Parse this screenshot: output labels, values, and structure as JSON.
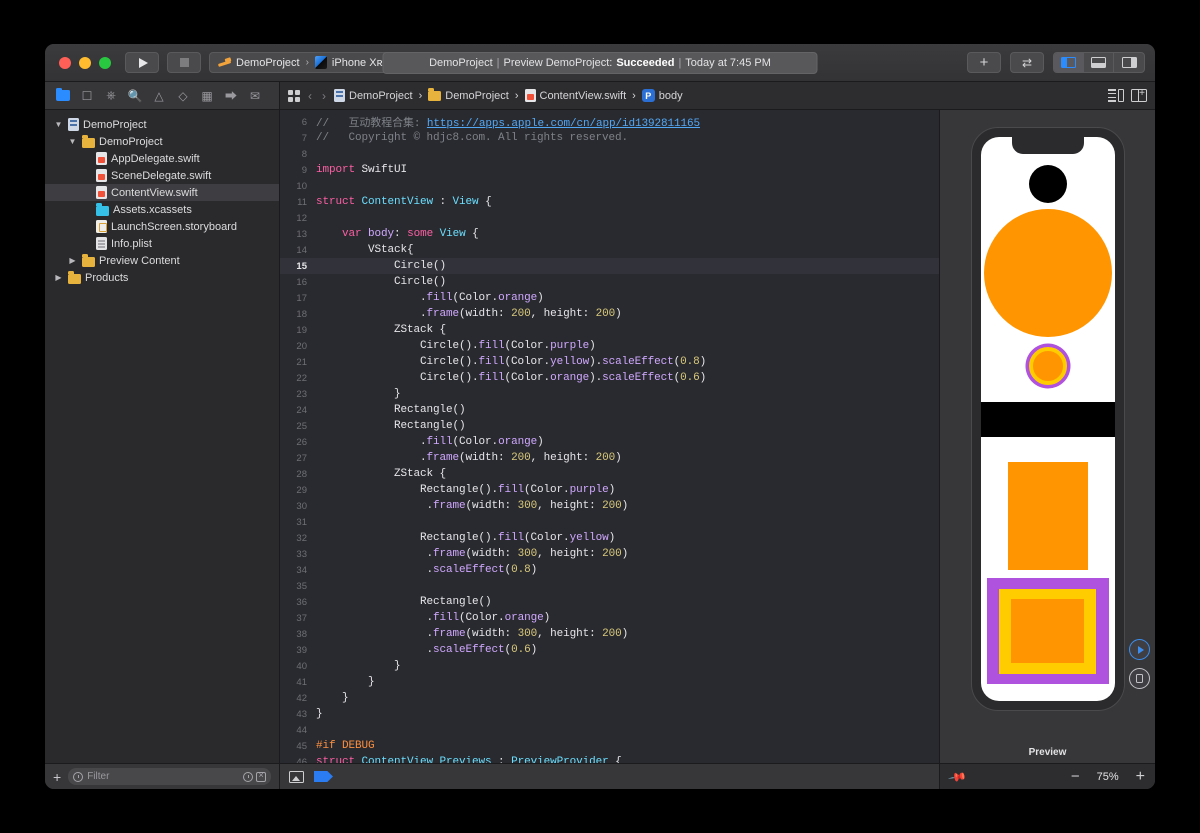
{
  "window": {
    "traffic_lights": [
      "close",
      "minimize",
      "zoom"
    ],
    "run_button": "run",
    "stop_button": "stop",
    "scheme": {
      "project": "DemoProject",
      "chevron": "›",
      "device": "iPhone Xʀ"
    },
    "status": {
      "project": "DemoProject",
      "sep": "|",
      "activity": "Preview DemoProject:",
      "result": "Succeeded",
      "time": "Today at 7:45 PM"
    },
    "right_buttons": {
      "add": "+",
      "swap": "⇄"
    },
    "pane_toggles": [
      "navigator-pane",
      "debug-pane",
      "inspector-pane"
    ]
  },
  "navigator_toolbar": {
    "icons": [
      "project-navigator-icon",
      "source-control-navigator-icon",
      "symbol-navigator-icon",
      "find-navigator-icon",
      "issue-navigator-icon",
      "test-navigator-icon",
      "debug-navigator-icon",
      "breakpoint-navigator-icon",
      "report-navigator-icon"
    ]
  },
  "jumpbar": {
    "back": "‹",
    "forward": "›",
    "separator": "›",
    "crumbs": [
      {
        "label": "DemoProject",
        "icon": "project-icon"
      },
      {
        "label": "DemoProject",
        "icon": "folder-icon"
      },
      {
        "label": "ContentView.swift",
        "icon": "swift-file-icon"
      },
      {
        "label": "body",
        "icon": "property-badge"
      }
    ],
    "badge_letter": "P"
  },
  "navigator": {
    "tree": [
      {
        "label": "DemoProject",
        "depth": 0,
        "twisty": "▼",
        "icon": "proj",
        "selected": false
      },
      {
        "label": "DemoProject",
        "depth": 1,
        "twisty": "▼",
        "icon": "folder",
        "selected": false
      },
      {
        "label": "AppDelegate.swift",
        "depth": 2,
        "twisty": "",
        "icon": "swift",
        "selected": false
      },
      {
        "label": "SceneDelegate.swift",
        "depth": 2,
        "twisty": "",
        "icon": "swift",
        "selected": false
      },
      {
        "label": "ContentView.swift",
        "depth": 2,
        "twisty": "",
        "icon": "swift",
        "selected": true
      },
      {
        "label": "Assets.xcassets",
        "depth": 2,
        "twisty": "",
        "icon": "assets",
        "selected": false
      },
      {
        "label": "LaunchScreen.storyboard",
        "depth": 2,
        "twisty": "",
        "icon": "story",
        "selected": false
      },
      {
        "label": "Info.plist",
        "depth": 2,
        "twisty": "",
        "icon": "plist",
        "selected": false
      },
      {
        "label": "Preview Content",
        "depth": 1,
        "twisty": "▶",
        "icon": "folder",
        "selected": false
      },
      {
        "label": "Products",
        "depth": 0,
        "twisty": "▶",
        "icon": "folder",
        "selected": false
      }
    ],
    "filter": {
      "add_label": "+",
      "placeholder": "Filter",
      "recent_icon": "clock-icon",
      "clear_icon": "clear-icon"
    }
  },
  "editor": {
    "current_line": 15,
    "lines": [
      {
        "n": 6,
        "tokens": [
          {
            "t": "//   互动教程合集: ",
            "c": "cmt"
          },
          {
            "t": "https://apps.apple.com/cn/app/id1392811165",
            "c": "lnk"
          }
        ]
      },
      {
        "n": 7,
        "tokens": [
          {
            "t": "//   Copyright © hdjc8.com. All rights reserved.",
            "c": "cmt"
          }
        ]
      },
      {
        "n": 8,
        "tokens": []
      },
      {
        "n": 9,
        "tokens": [
          {
            "t": "import ",
            "c": "kw"
          },
          {
            "t": "SwiftUI",
            "c": "pln"
          }
        ]
      },
      {
        "n": 10,
        "tokens": []
      },
      {
        "n": 11,
        "tokens": [
          {
            "t": "struct ",
            "c": "kw"
          },
          {
            "t": "ContentView",
            "c": "typ"
          },
          {
            "t": " : ",
            "c": "pln"
          },
          {
            "t": "View",
            "c": "typ"
          },
          {
            "t": " {",
            "c": "pln"
          }
        ]
      },
      {
        "n": 12,
        "tokens": []
      },
      {
        "n": 13,
        "tokens": [
          {
            "t": "    ",
            "c": "pln"
          },
          {
            "t": "var ",
            "c": "kw"
          },
          {
            "t": "body",
            "c": "idn"
          },
          {
            "t": ": ",
            "c": "pln"
          },
          {
            "t": "some ",
            "c": "kw"
          },
          {
            "t": "View",
            "c": "typ"
          },
          {
            "t": " {",
            "c": "pln"
          }
        ]
      },
      {
        "n": 14,
        "tokens": [
          {
            "t": "        VStack{",
            "c": "pln"
          }
        ]
      },
      {
        "n": 15,
        "tokens": [
          {
            "t": "            Circle()",
            "c": "pln"
          }
        ]
      },
      {
        "n": 16,
        "tokens": [
          {
            "t": "            Circle()",
            "c": "pln"
          }
        ]
      },
      {
        "n": 17,
        "tokens": [
          {
            "t": "                .",
            "c": "pln"
          },
          {
            "t": "fill",
            "c": "mem"
          },
          {
            "t": "(Color.",
            "c": "pln"
          },
          {
            "t": "orange",
            "c": "mem"
          },
          {
            "t": ")",
            "c": "pln"
          }
        ]
      },
      {
        "n": 18,
        "tokens": [
          {
            "t": "                .",
            "c": "pln"
          },
          {
            "t": "frame",
            "c": "mem"
          },
          {
            "t": "(width: ",
            "c": "pln"
          },
          {
            "t": "200",
            "c": "num"
          },
          {
            "t": ", height: ",
            "c": "pln"
          },
          {
            "t": "200",
            "c": "num"
          },
          {
            "t": ")",
            "c": "pln"
          }
        ]
      },
      {
        "n": 19,
        "tokens": [
          {
            "t": "            ZStack {",
            "c": "pln"
          }
        ]
      },
      {
        "n": 20,
        "tokens": [
          {
            "t": "                Circle().",
            "c": "pln"
          },
          {
            "t": "fill",
            "c": "mem"
          },
          {
            "t": "(Color.",
            "c": "pln"
          },
          {
            "t": "purple",
            "c": "mem"
          },
          {
            "t": ")",
            "c": "pln"
          }
        ]
      },
      {
        "n": 21,
        "tokens": [
          {
            "t": "                Circle().",
            "c": "pln"
          },
          {
            "t": "fill",
            "c": "mem"
          },
          {
            "t": "(Color.",
            "c": "pln"
          },
          {
            "t": "yellow",
            "c": "mem"
          },
          {
            "t": ").",
            "c": "pln"
          },
          {
            "t": "scaleEffect",
            "c": "mem"
          },
          {
            "t": "(",
            "c": "pln"
          },
          {
            "t": "0.8",
            "c": "num"
          },
          {
            "t": ")",
            "c": "pln"
          }
        ]
      },
      {
        "n": 22,
        "tokens": [
          {
            "t": "                Circle().",
            "c": "pln"
          },
          {
            "t": "fill",
            "c": "mem"
          },
          {
            "t": "(Color.",
            "c": "pln"
          },
          {
            "t": "orange",
            "c": "mem"
          },
          {
            "t": ").",
            "c": "pln"
          },
          {
            "t": "scaleEffect",
            "c": "mem"
          },
          {
            "t": "(",
            "c": "pln"
          },
          {
            "t": "0.6",
            "c": "num"
          },
          {
            "t": ")",
            "c": "pln"
          }
        ]
      },
      {
        "n": 23,
        "tokens": [
          {
            "t": "            }",
            "c": "pln"
          }
        ]
      },
      {
        "n": 24,
        "tokens": [
          {
            "t": "            Rectangle()",
            "c": "pln"
          }
        ]
      },
      {
        "n": 25,
        "tokens": [
          {
            "t": "            Rectangle()",
            "c": "pln"
          }
        ]
      },
      {
        "n": 26,
        "tokens": [
          {
            "t": "                .",
            "c": "pln"
          },
          {
            "t": "fill",
            "c": "mem"
          },
          {
            "t": "(Color.",
            "c": "pln"
          },
          {
            "t": "orange",
            "c": "mem"
          },
          {
            "t": ")",
            "c": "pln"
          }
        ]
      },
      {
        "n": 27,
        "tokens": [
          {
            "t": "                .",
            "c": "pln"
          },
          {
            "t": "frame",
            "c": "mem"
          },
          {
            "t": "(width: ",
            "c": "pln"
          },
          {
            "t": "200",
            "c": "num"
          },
          {
            "t": ", height: ",
            "c": "pln"
          },
          {
            "t": "200",
            "c": "num"
          },
          {
            "t": ")",
            "c": "pln"
          }
        ]
      },
      {
        "n": 28,
        "tokens": [
          {
            "t": "            ZStack {",
            "c": "pln"
          }
        ]
      },
      {
        "n": 29,
        "tokens": [
          {
            "t": "                Rectangle().",
            "c": "pln"
          },
          {
            "t": "fill",
            "c": "mem"
          },
          {
            "t": "(Color.",
            "c": "pln"
          },
          {
            "t": "purple",
            "c": "mem"
          },
          {
            "t": ")",
            "c": "pln"
          }
        ]
      },
      {
        "n": 30,
        "tokens": [
          {
            "t": "                 .",
            "c": "pln"
          },
          {
            "t": "frame",
            "c": "mem"
          },
          {
            "t": "(width: ",
            "c": "pln"
          },
          {
            "t": "300",
            "c": "num"
          },
          {
            "t": ", height: ",
            "c": "pln"
          },
          {
            "t": "200",
            "c": "num"
          },
          {
            "t": ")",
            "c": "pln"
          }
        ]
      },
      {
        "n": 31,
        "tokens": []
      },
      {
        "n": 32,
        "tokens": [
          {
            "t": "                Rectangle().",
            "c": "pln"
          },
          {
            "t": "fill",
            "c": "mem"
          },
          {
            "t": "(Color.",
            "c": "pln"
          },
          {
            "t": "yellow",
            "c": "mem"
          },
          {
            "t": ")",
            "c": "pln"
          }
        ]
      },
      {
        "n": 33,
        "tokens": [
          {
            "t": "                 .",
            "c": "pln"
          },
          {
            "t": "frame",
            "c": "mem"
          },
          {
            "t": "(width: ",
            "c": "pln"
          },
          {
            "t": "300",
            "c": "num"
          },
          {
            "t": ", height: ",
            "c": "pln"
          },
          {
            "t": "200",
            "c": "num"
          },
          {
            "t": ")",
            "c": "pln"
          }
        ]
      },
      {
        "n": 34,
        "tokens": [
          {
            "t": "                 .",
            "c": "pln"
          },
          {
            "t": "scaleEffect",
            "c": "mem"
          },
          {
            "t": "(",
            "c": "pln"
          },
          {
            "t": "0.8",
            "c": "num"
          },
          {
            "t": ")",
            "c": "pln"
          }
        ]
      },
      {
        "n": 35,
        "tokens": []
      },
      {
        "n": 36,
        "tokens": [
          {
            "t": "                Rectangle()",
            "c": "pln"
          }
        ]
      },
      {
        "n": 37,
        "tokens": [
          {
            "t": "                 .",
            "c": "pln"
          },
          {
            "t": "fill",
            "c": "mem"
          },
          {
            "t": "(Color.",
            "c": "pln"
          },
          {
            "t": "orange",
            "c": "mem"
          },
          {
            "t": ")",
            "c": "pln"
          }
        ]
      },
      {
        "n": 38,
        "tokens": [
          {
            "t": "                 .",
            "c": "pln"
          },
          {
            "t": "frame",
            "c": "mem"
          },
          {
            "t": "(width: ",
            "c": "pln"
          },
          {
            "t": "300",
            "c": "num"
          },
          {
            "t": ", height: ",
            "c": "pln"
          },
          {
            "t": "200",
            "c": "num"
          },
          {
            "t": ")",
            "c": "pln"
          }
        ]
      },
      {
        "n": 39,
        "tokens": [
          {
            "t": "                 .",
            "c": "pln"
          },
          {
            "t": "scaleEffect",
            "c": "mem"
          },
          {
            "t": "(",
            "c": "pln"
          },
          {
            "t": "0.6",
            "c": "num"
          },
          {
            "t": ")",
            "c": "pln"
          }
        ]
      },
      {
        "n": 40,
        "tokens": [
          {
            "t": "            }",
            "c": "pln"
          }
        ]
      },
      {
        "n": 41,
        "tokens": [
          {
            "t": "        }",
            "c": "pln"
          }
        ]
      },
      {
        "n": 42,
        "tokens": [
          {
            "t": "    }",
            "c": "pln"
          }
        ]
      },
      {
        "n": 43,
        "tokens": [
          {
            "t": "}",
            "c": "pln"
          }
        ]
      },
      {
        "n": 44,
        "tokens": []
      },
      {
        "n": 45,
        "tokens": [
          {
            "t": "#if DEBUG",
            "c": "pre"
          }
        ]
      },
      {
        "n": 46,
        "tokens": [
          {
            "t": "struct ",
            "c": "kw"
          },
          {
            "t": "ContentView_Previews",
            "c": "typ"
          },
          {
            "t": " : ",
            "c": "pln"
          },
          {
            "t": "PreviewProvider",
            "c": "typ"
          },
          {
            "t": " {",
            "c": "pln"
          }
        ]
      }
    ],
    "bottom_icons": [
      "assistant-editor-icon",
      "issue-tag-icon"
    ]
  },
  "canvas": {
    "label": "Preview",
    "zoom": "75%",
    "zoom_out": "−",
    "zoom_in": "+",
    "pin_icon": "pin-icon",
    "live_preview_button": "play-circle-icon",
    "inspect_button": "inspect-circle-icon",
    "device": "iPhone Xʀ",
    "shapes": [
      {
        "name": "black-circle",
        "type": "circle",
        "color": "#000000"
      },
      {
        "name": "orange-circle",
        "type": "circle",
        "color": "#ff9500"
      },
      {
        "name": "zstack-circle-ring",
        "type": "circle",
        "colors": [
          "#af52de",
          "#ffcc00",
          "#ff9500"
        ]
      },
      {
        "name": "black-rectangle",
        "type": "rect",
        "color": "#000000"
      },
      {
        "name": "orange-rectangle",
        "type": "rect",
        "color": "#ff9500"
      },
      {
        "name": "zstack-nested-rects",
        "type": "rect",
        "colors": [
          "#af52de",
          "#ffcc00",
          "#ff9500"
        ]
      }
    ]
  },
  "colors": {
    "accent": "#2b8cff",
    "orange": "#ff9500",
    "purple": "#af52de",
    "yellow": "#ffcc00",
    "window_bg": "#2c2c2e",
    "editor_bg": "#292a2f"
  }
}
